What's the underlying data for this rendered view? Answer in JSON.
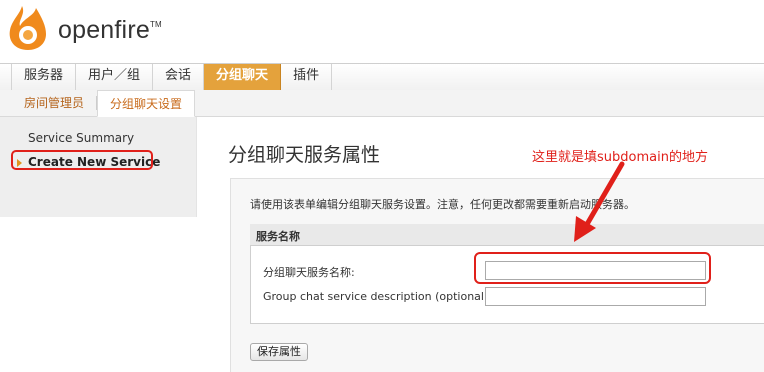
{
  "brand": {
    "name": "openfire",
    "tm": "TM"
  },
  "main_nav": {
    "tabs": [
      {
        "label": "服务器",
        "active": false
      },
      {
        "label": "用户／组",
        "active": false
      },
      {
        "label": "会话",
        "active": false
      },
      {
        "label": "分组聊天",
        "active": true
      },
      {
        "label": "插件",
        "active": false
      }
    ]
  },
  "sub_nav": {
    "tabs": [
      {
        "label": "房间管理员",
        "active": false
      },
      {
        "label": "分组聊天设置",
        "active": true
      }
    ]
  },
  "sidebar": {
    "items": [
      {
        "label": "Service Summary",
        "active": false
      },
      {
        "label": "Create New Service",
        "active": true
      }
    ]
  },
  "page": {
    "title": "分组聊天服务属性",
    "annotation": "这里就是填subdomain的地方",
    "instructions": "请使用该表单编辑分组聊天服务设置。注意，任何更改都需要重新启动服务器。",
    "section_title": "服务名称",
    "fields": {
      "name_label": "分组聊天服务名称:",
      "name_value": "",
      "description_label": "Group chat service description (optional):",
      "description_value": ""
    },
    "save_label": "保存属性"
  },
  "colors": {
    "accent": "#e4a23c",
    "annotation_red": "#e0201a",
    "logo_orange": "#f08a1c"
  }
}
